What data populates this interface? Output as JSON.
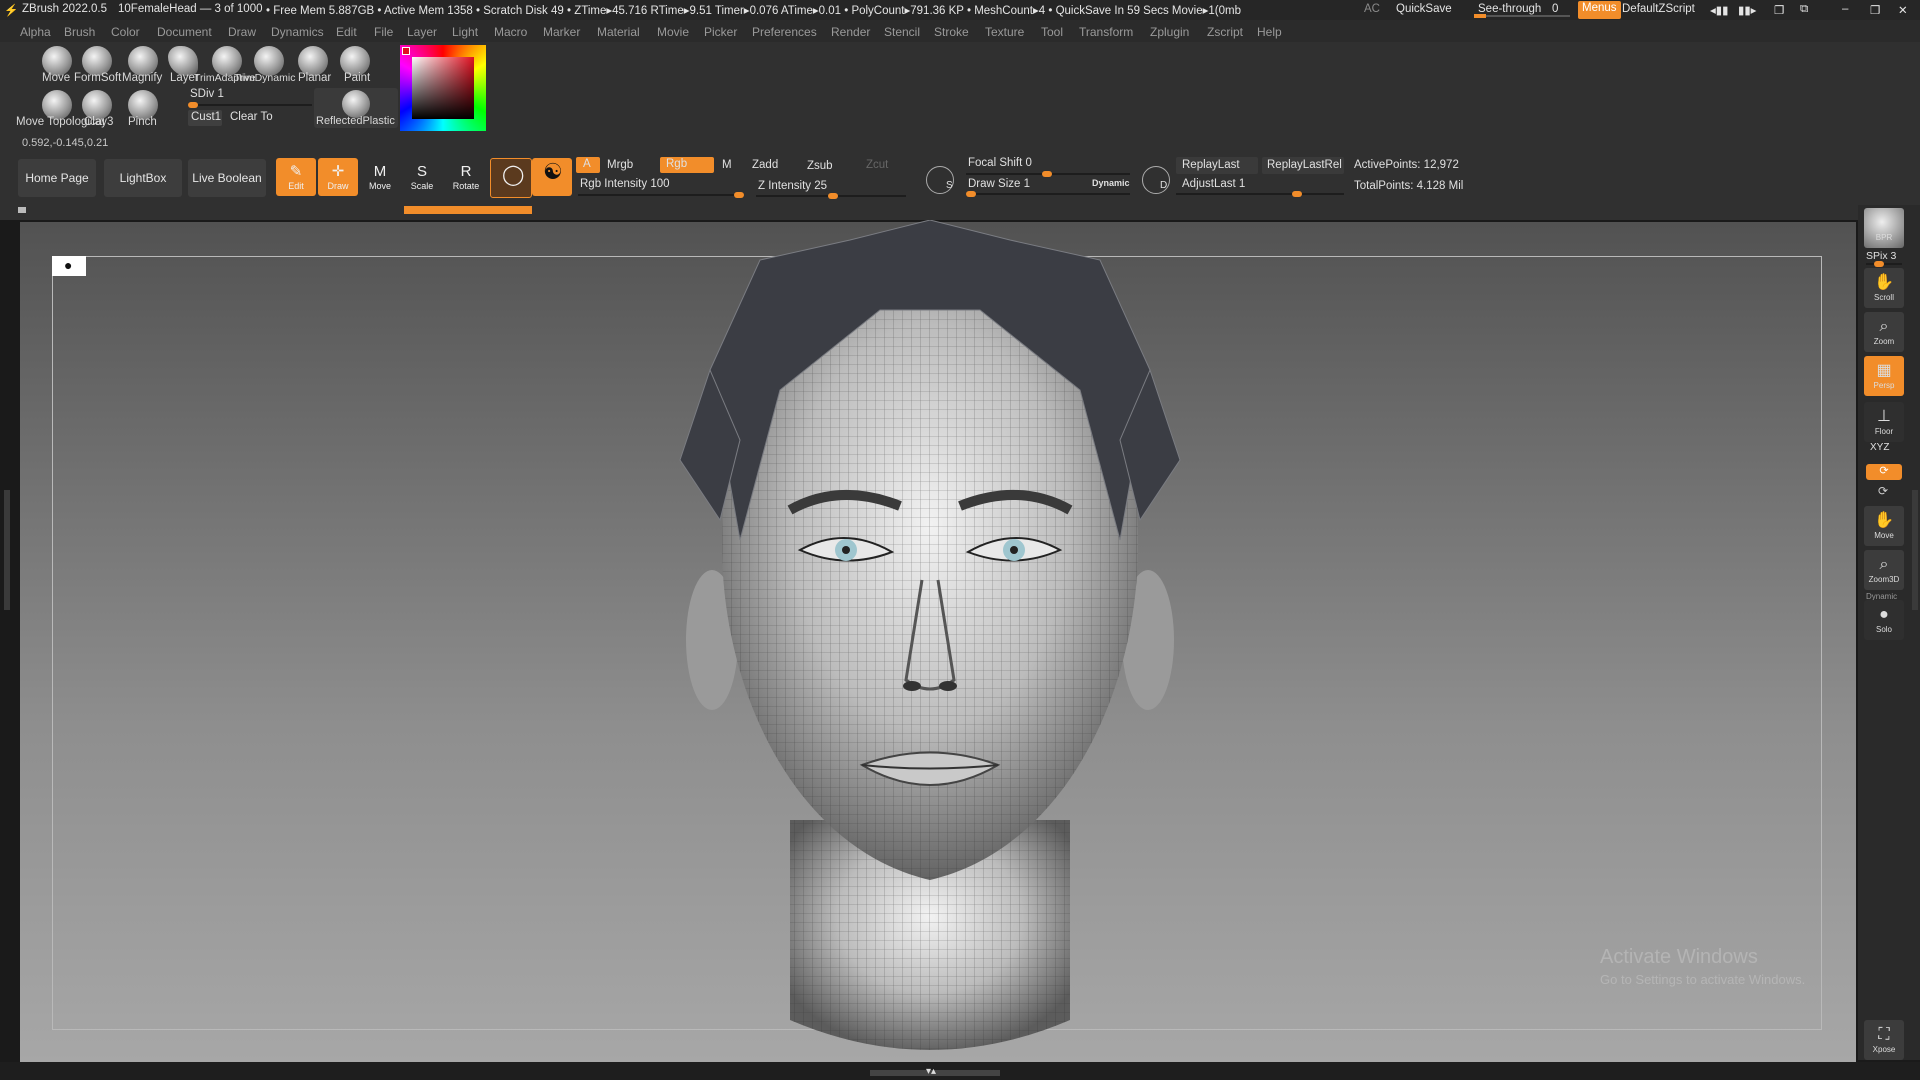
{
  "titlebar": {
    "app": "ZBrush 2022.0.5",
    "document": "10FemaleHead — 3 of 1000",
    "stats": "• Free Mem 5.887GB • Active Mem 1358 • Scratch Disk 49 • ZTime▸45.716 RTime▸9.51 Timer▸0.076 ATime▸0.01 • PolyCount▸791.36 KP • MeshCount▸4 • QuickSave In 59 Secs Movie▸1(0mb",
    "ac": "AC",
    "quicksave": "QuickSave",
    "seethrough_label": "See-through",
    "seethrough_value": "0",
    "menus": "Menus",
    "script": "DefaultZScript"
  },
  "menubar": [
    "Alpha",
    "Brush",
    "Color",
    "Document",
    "Draw",
    "Dynamics",
    "Edit",
    "File",
    "Layer",
    "Light",
    "Macro",
    "Marker",
    "Material",
    "Movie",
    "Picker",
    "Preferences",
    "Render",
    "Stencil",
    "Stroke",
    "Texture",
    "Tool",
    "Transform",
    "Zplugin",
    "Zscript",
    "Help"
  ],
  "shelf": {
    "brushes_row1": [
      "Move",
      "FormSoft",
      "Magnify",
      "Layer",
      "TrimAdaptive",
      "TrimDynamic",
      "Planar",
      "Paint"
    ],
    "brushes_row2": [
      "Move Topological",
      "Clay3",
      "Pinch"
    ],
    "sdiv": "SDiv 1",
    "cust": "Cust1",
    "clear_to": "Clear To",
    "material": "ReflectedPlastic",
    "coords": "0.592,-0.145,0.21"
  },
  "toolbar": {
    "home_page": "Home Page",
    "lightbox": "LightBox",
    "live_boolean": "Live Boolean",
    "edit": "Edit",
    "draw": "Draw",
    "move": "Move",
    "scale": "Scale",
    "rotate": "Rotate",
    "a": "A",
    "mrgb": "Mrgb",
    "rgb": "Rgb",
    "m": "M",
    "zadd": "Zadd",
    "zsub": "Zsub",
    "zcut": "Zcut",
    "rgb_intensity": "Rgb Intensity 100",
    "z_intensity": "Z Intensity 25",
    "focal_shift": "Focal Shift 0",
    "draw_size": "Draw Size 1",
    "dynamic": "Dynamic",
    "replay_last": "ReplayLast",
    "replay_last_rel": "ReplayLastRel",
    "adjust_last": "AdjustLast 1",
    "active_points": "ActivePoints: 12,972",
    "total_points": "TotalPoints: 4.128 Mil",
    "s": "S",
    "d": "D"
  },
  "right_tray": {
    "bpr": "BPR",
    "spix": "SPix 3",
    "scroll": "Scroll",
    "zoom": "Zoom",
    "persp": "Persp",
    "floor": "Floor",
    "xyz": "XYZ",
    "move": "Move",
    "zoom3d": "Zoom3D",
    "dynamic": "Dynamic",
    "solo": "Solo",
    "xpose": "Xpose"
  },
  "watermark": {
    "line1": "Activate Windows",
    "line2": "Go to Settings to activate Windows."
  },
  "colors": {
    "accent": "#f28d2a",
    "panel": "#303030",
    "viewport_top": "#525252",
    "viewport_bottom": "#a7a7a7"
  }
}
